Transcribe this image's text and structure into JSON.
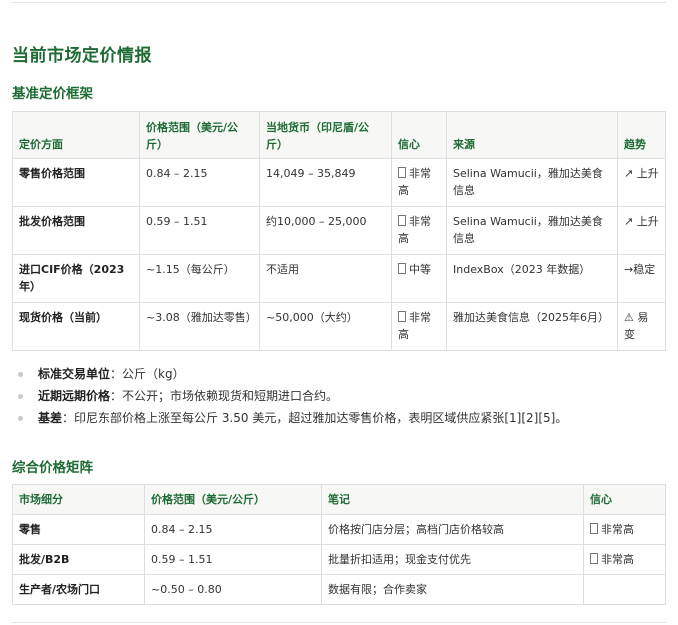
{
  "page_title": "当前市场定价情报",
  "section1": {
    "title": "基准定价框架",
    "headers": [
      "定价方面",
      "价格范围（美元/公斤）",
      "当地货币（印尼盾/公斤）",
      "信心",
      "来源",
      "趋势"
    ],
    "rows": [
      [
        "零售价格范围",
        "0.84 – 2.15",
        "14,049 – 35,849",
        "非常高",
        "Selina Wamucii，雅加达美食信息",
        "↗ 上升"
      ],
      [
        "批发价格范围",
        "0.59 – 1.51",
        "约10,000 – 25,000",
        "非常高",
        "Selina Wamucii，雅加达美食信息",
        "↗ 上升"
      ],
      [
        "进口CIF价格（2023年）",
        "~1.15（每公斤）",
        "不适用",
        "中等",
        "IndexBox（2023 年数据）",
        "→稳定"
      ],
      [
        "现货价格（当前）",
        "~3.08（雅加达零售）",
        "~50,000（大约）",
        "非常高",
        "雅加达美食信息（2025年6月）",
        "⚠ 易变"
      ]
    ]
  },
  "notes": [
    {
      "label": "标准交易单位",
      "text": "：公斤（kg）"
    },
    {
      "label": "近期远期价格",
      "text": "：不公开；市场依赖现货和短期进口合约。"
    },
    {
      "label": "基差",
      "text": "：印尼东部价格上涨至每公斤 3.50 美元，超过雅加达零售价格，表明区域供应紧张[1][2][5]。"
    }
  ],
  "section2": {
    "title": "综合价格矩阵",
    "headers": [
      "市场细分",
      "价格范围（美元/公斤）",
      "笔记",
      "信心"
    ],
    "rows": [
      [
        "零售",
        "0.84 – 2.15",
        "价格按门店分层；高档门店价格较高",
        "非常高"
      ],
      [
        "批发/B2B",
        "0.59 – 1.51",
        "批量折扣适用；现金支付优先",
        "非常高"
      ],
      [
        "生产者/农场门口",
        "~0.50 – 0.80",
        "数据有限；合作卖家",
        ""
      ]
    ]
  }
}
